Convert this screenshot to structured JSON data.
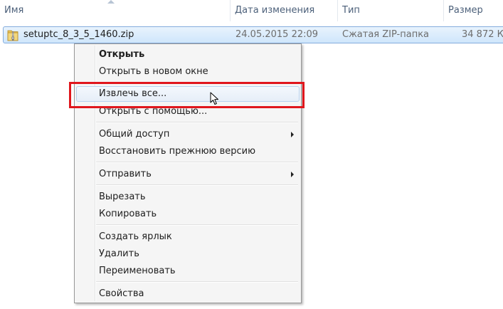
{
  "columns": {
    "name": "Имя",
    "date": "Дата изменения",
    "type": "Тип",
    "size": "Размер"
  },
  "file": {
    "name": "setuptc_8_3_5_1460.zip",
    "date": "24.05.2015 22:09",
    "type": "Сжатая ZIP-папка",
    "size": "34 872 КБ",
    "icon": "zip-folder-icon"
  },
  "context_menu": {
    "open": "Открыть",
    "open_new_window": "Открыть в новом окне",
    "extract_all": "Извлечь все...",
    "open_with": "Открыть с помощью...",
    "share": "Общий доступ",
    "restore_previous": "Восстановить прежнюю версию",
    "send_to": "Отправить",
    "cut": "Вырезать",
    "copy": "Копировать",
    "create_shortcut": "Создать ярлык",
    "delete": "Удалить",
    "rename": "Переименовать",
    "properties": "Свойства"
  },
  "colors": {
    "highlight_box": "#e0161c",
    "selection_border": "#84acdd",
    "header_text": "#4c607a"
  }
}
